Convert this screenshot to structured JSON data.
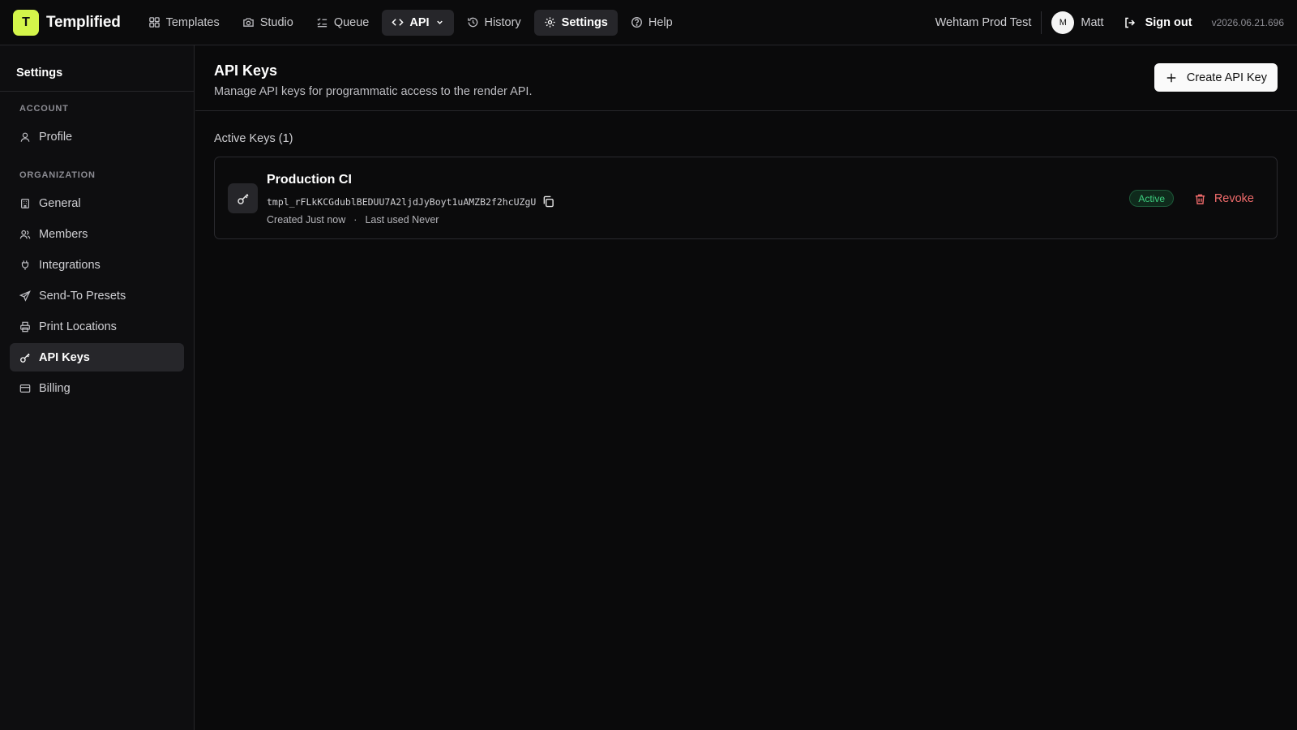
{
  "app": {
    "logo_letter": "T",
    "name": "Templified",
    "accent": "#d4f54a"
  },
  "nav": {
    "items": [
      {
        "label": "Templates",
        "icon": "grid-icon"
      },
      {
        "label": "Studio",
        "icon": "camera-icon"
      },
      {
        "label": "Queue",
        "icon": "list-check-icon"
      },
      {
        "label": "API",
        "icon": "code-icon"
      },
      {
        "label": "History",
        "icon": "history-icon"
      },
      {
        "label": "Settings",
        "icon": "gear-icon"
      },
      {
        "label": "Help",
        "icon": "help-circle-icon"
      }
    ],
    "active": "Settings"
  },
  "header": {
    "org_name": "Wehtam Prod Test",
    "avatar_letter": "M",
    "user_name": "Matt",
    "sign_out": "Sign out",
    "version": "v2026.06.21.696"
  },
  "sidebar": {
    "title": "Settings",
    "account_heading": "ACCOUNT",
    "account_items": [
      {
        "label": "Profile",
        "icon": "user-icon"
      }
    ],
    "org_heading": "ORGANIZATION",
    "org_items": [
      {
        "label": "General",
        "icon": "building-icon"
      },
      {
        "label": "Members",
        "icon": "users-icon"
      },
      {
        "label": "Integrations",
        "icon": "plug-icon"
      },
      {
        "label": "Send-To Presets",
        "icon": "send-icon"
      },
      {
        "label": "Print Locations",
        "icon": "printer-icon"
      },
      {
        "label": "API Keys",
        "icon": "key-icon"
      },
      {
        "label": "Billing",
        "icon": "credit-card-icon"
      }
    ],
    "active": "API Keys"
  },
  "main": {
    "title": "API Keys",
    "subtitle": "Manage API keys for programmatic access to the render API.",
    "create_button": "Create API Key",
    "section_label": "Active Keys (1)",
    "keys": [
      {
        "name": "Production CI",
        "token": "tmpl_rFLkKCGdublBEDUU7A2ljdJyBoyt1uAMZB2f2hcUZgU",
        "created": "Created Just now",
        "separator": "·",
        "last_used": "Last used Never",
        "status": "Active",
        "revoke_label": "Revoke"
      }
    ]
  },
  "colors": {
    "status_active": "#3ecf7f",
    "revoke": "#f06b6b"
  }
}
